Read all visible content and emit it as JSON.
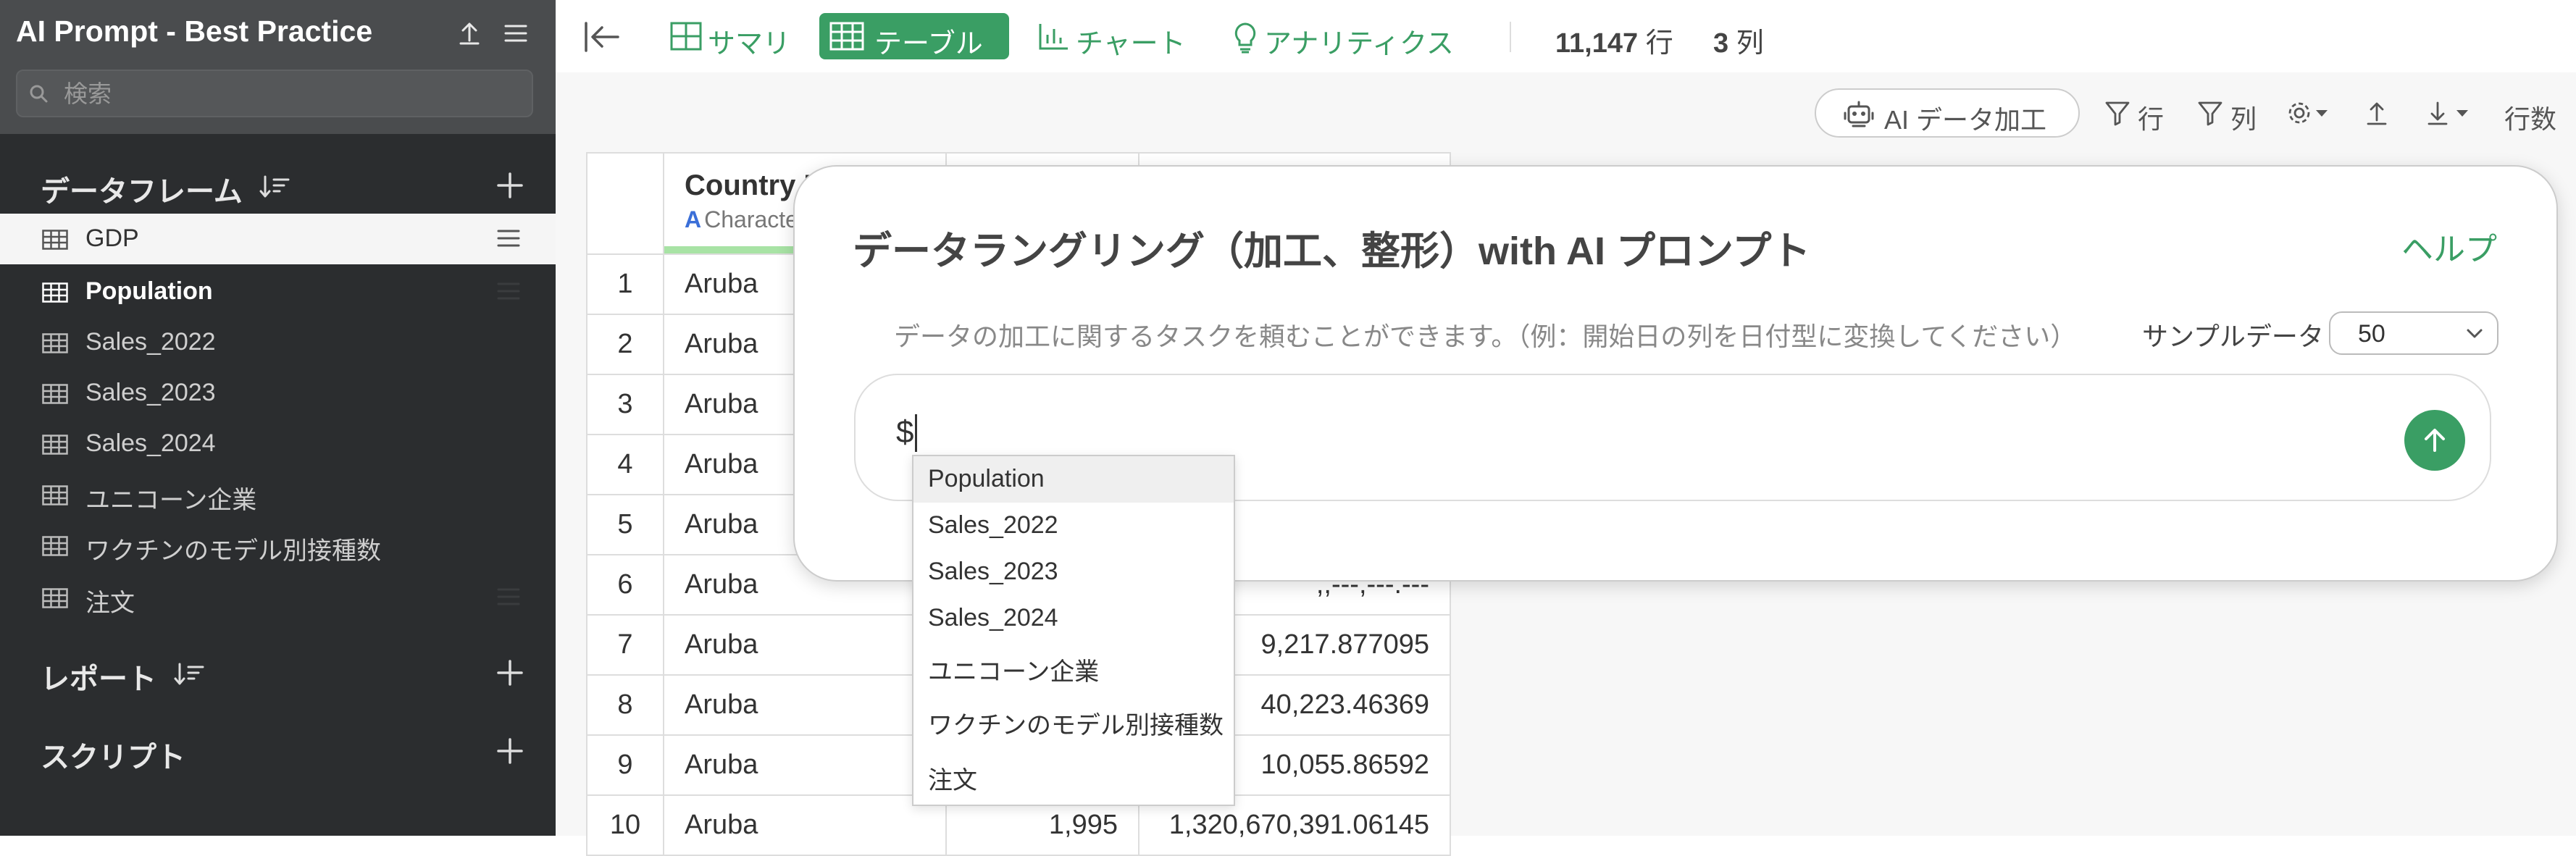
{
  "app": {
    "title": "AI Prompt - Best Practice"
  },
  "sidebar": {
    "search_placeholder": "検索",
    "dataframes_title": "データフレーム",
    "dataframes": [
      {
        "label": "GDP"
      },
      {
        "label": "Population"
      },
      {
        "label": "Sales_2022"
      },
      {
        "label": "Sales_2023"
      },
      {
        "label": "Sales_2024"
      },
      {
        "label": "ユニコーン企業"
      },
      {
        "label": "ワクチンのモデル別接種数"
      },
      {
        "label": "注文"
      }
    ],
    "reports_title": "レポート",
    "scripts_title": "スクリプト"
  },
  "toolbar": {
    "tabs": [
      {
        "label": "サマリ"
      },
      {
        "label": "テーブル"
      },
      {
        "label": "チャート"
      },
      {
        "label": "アナリティクス"
      }
    ],
    "rows_count": "11,147",
    "rows_unit": "行",
    "cols_count": "3",
    "cols_unit": "列"
  },
  "toolbar2": {
    "ai_data_label": "AI データ加工",
    "row_filter": "行",
    "col_filter": "列",
    "rows_label": "行数"
  },
  "table": {
    "col1_name": "Country N",
    "col1_type": "Characte",
    "rows": [
      {
        "n": "1",
        "c1": "Aruba",
        "c2": "",
        "c3": ""
      },
      {
        "n": "2",
        "c1": "Aruba",
        "c2": "",
        "c3": ""
      },
      {
        "n": "3",
        "c1": "Aruba",
        "c2": "",
        "c3": ""
      },
      {
        "n": "4",
        "c1": "Aruba",
        "c2": "",
        "c3": ""
      },
      {
        "n": "5",
        "c1": "Aruba",
        "c2": "",
        "c3": ""
      },
      {
        "n": "6",
        "c1": "Aruba",
        "c2": "",
        "c3": ",,---,---.---"
      },
      {
        "n": "7",
        "c1": "Aruba",
        "c2": "",
        "c3": "9,217.877095"
      },
      {
        "n": "8",
        "c1": "Aruba",
        "c2": "",
        "c3": "40,223.46369"
      },
      {
        "n": "9",
        "c1": "Aruba",
        "c2": "",
        "c3": "10,055.86592"
      },
      {
        "n": "10",
        "c1": "Aruba",
        "c2": "1,995",
        "c3": "1,320,670,391.06145"
      }
    ]
  },
  "dialog": {
    "title": "データラングリング（加工、整形）with AI プロンプト",
    "help": "ヘルプ",
    "placeholder": "データの加工に関するタスクを頼むことができます。（例：開始日の列を日付型に変換してください）",
    "sample_label": "サンプルデータ",
    "sample_value": "50",
    "input_value": "$"
  },
  "autocomplete": {
    "items": [
      {
        "label": "Population"
      },
      {
        "label": "Sales_2022"
      },
      {
        "label": "Sales_2023"
      },
      {
        "label": "Sales_2024"
      },
      {
        "label": "ユニコーン企業"
      },
      {
        "label": "ワクチンのモデル別接種数"
      },
      {
        "label": "注文"
      }
    ]
  },
  "colors": {
    "accent": "#3a9e64",
    "sidebar_bg": "#2b2d2f",
    "sidebar_header_bg": "#4a4c4e"
  }
}
